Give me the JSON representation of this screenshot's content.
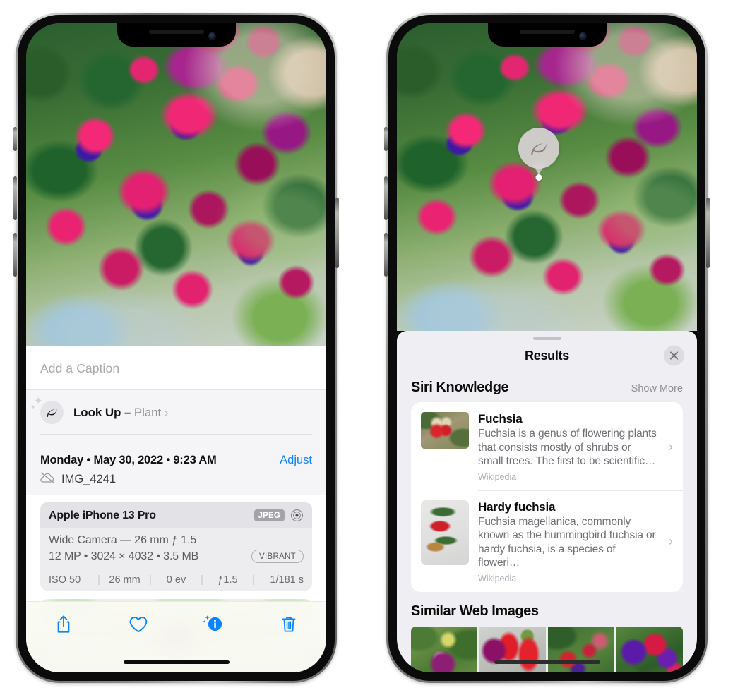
{
  "left_phone": {
    "caption_field": {
      "placeholder": "Add a Caption",
      "value": ""
    },
    "look_up": {
      "icon": "leaf-icon",
      "label": "Look Up – ",
      "subject": "Plant",
      "chevron": "›"
    },
    "meta": {
      "date": "Monday • May 30, 2022 • 9:23 AM",
      "adjust_label": "Adjust",
      "cloud_icon": "cloud-slash-icon",
      "filename": "IMG_4241"
    },
    "camera_card": {
      "device": "Apple iPhone 13 Pro",
      "format_badge": "JPEG",
      "aperture_icon": "aperture-icon",
      "lens_line": "Wide Camera — 26 mm ƒ 1.5",
      "file_line": "12 MP • 3024 × 4032 • 3.5 MB",
      "style_badge": "VIBRANT",
      "exif": [
        "ISO 50",
        "26 mm",
        "0 ev",
        "ƒ1.5",
        "1/181 s"
      ]
    },
    "toolbar": [
      {
        "name": "share-button",
        "icon": "share-icon"
      },
      {
        "name": "favorite-button",
        "icon": "heart-icon"
      },
      {
        "name": "info-button",
        "icon": "info-sparkle-icon"
      },
      {
        "name": "delete-button",
        "icon": "trash-icon"
      }
    ],
    "accent_color": "#0a84ff"
  },
  "right_phone": {
    "marker": {
      "icon": "leaf-icon"
    },
    "sheet": {
      "title": "Results",
      "close_icon": "close-icon"
    },
    "siri_knowledge": {
      "section_title": "Siri Knowledge",
      "action_label": "Show More",
      "items": [
        {
          "title": "Fuchsia",
          "description": "Fuchsia is a genus of flowering plants that consists mostly of shrubs or small trees. The first to be scientific…",
          "source": "Wikipedia",
          "chevron": "›"
        },
        {
          "title": "Hardy fuchsia",
          "description": "Fuchsia magellanica, commonly known as the hummingbird fuchsia or hardy fuchsia, is a species of floweri…",
          "source": "Wikipedia",
          "chevron": "›"
        }
      ]
    },
    "similar_web_images": {
      "section_title": "Similar Web Images",
      "tiles": [
        "fuchsia-thumb-1",
        "fuchsia-thumb-2",
        "fuchsia-thumb-3",
        "fuchsia-thumb-4"
      ]
    }
  }
}
